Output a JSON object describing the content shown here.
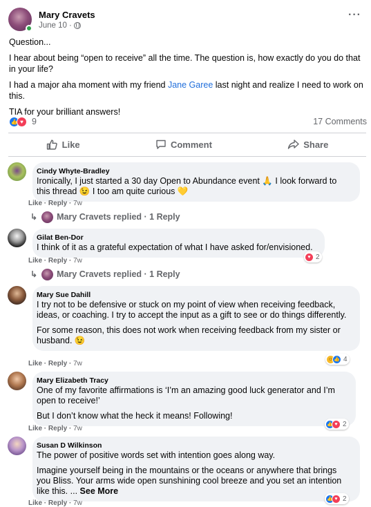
{
  "post": {
    "author": "Mary Cravets",
    "date": "June 10",
    "date_sep": "·",
    "more_icon": "ellipsis-icon",
    "paragraphs": {
      "p1": "Question...",
      "p2": "I hear about being “open to receive” all the time. The question is, how exactly do you do that in your life?",
      "p3_before": "I had a major aha moment with my friend ",
      "p3_link": "Jane Garee",
      "p3_after": " last night and realize I need to work on this.",
      "p4": "TIA for your brilliant answers!"
    },
    "reaction_count": "9",
    "comment_count": "17 Comments"
  },
  "actions": {
    "like": "Like",
    "comment": "Comment",
    "share": "Share"
  },
  "comment_actions": {
    "like": "Like",
    "reply": "Reply",
    "sep": "·"
  },
  "comments": [
    {
      "name": "Cindy Whyte-Bradley",
      "text_1": "Ironically, I just started a 30 day Open to Abundance event ",
      "text_2": " I look forward to this thread ",
      "text_3": " I too am quite curious ",
      "emoji": [
        "🙏",
        "😉",
        "💛"
      ],
      "time": "7w",
      "replies": "Mary Cravets replied · 1 Reply"
    },
    {
      "name": "Gilat Ben-Dor",
      "text": "I think of it as a grateful expectation of what I have asked for/envisioned.",
      "time": "7w",
      "reaction_count": "2",
      "replies": "Mary Cravets replied · 1 Reply"
    },
    {
      "name": "Mary Sue Dahill",
      "text_p1": "I try not to be defensive or stuck on my point of view when receiving feedback, ideas, or coaching. I try to accept the input as a gift to see or do things differently.",
      "text_p2": "For some reason, this does not work when receiving feedback from my sister or husband. ",
      "emoji": "😉",
      "time": "7w",
      "reaction_count": "4"
    },
    {
      "name": "Mary Elizabeth Tracy",
      "text_p1": "One of my favorite affirmations is ‘I’m an amazing good luck generator and I’m open to receive!’",
      "text_p2": "But I don’t know what the heck it means! Following!",
      "time": "7w",
      "reaction_count": "2"
    },
    {
      "name": "Susan D Wilkinson",
      "text_p1": "The power of positive words set with intention goes along way.",
      "text_p2": "Imagine yourself being in the mountains or the oceans or anywhere that brings you Bliss. Your arms wide open sunshining cool breeze and you set an intention like this. ...",
      "see_more": "See More",
      "time": "7w",
      "reaction_count": "2"
    }
  ],
  "colors": {
    "like_blue": "#1877f2",
    "love_red": "#f33e58",
    "link_blue": "#216fdb",
    "bubble_gray": "#f0f2f5",
    "meta_gray": "#65676b"
  }
}
